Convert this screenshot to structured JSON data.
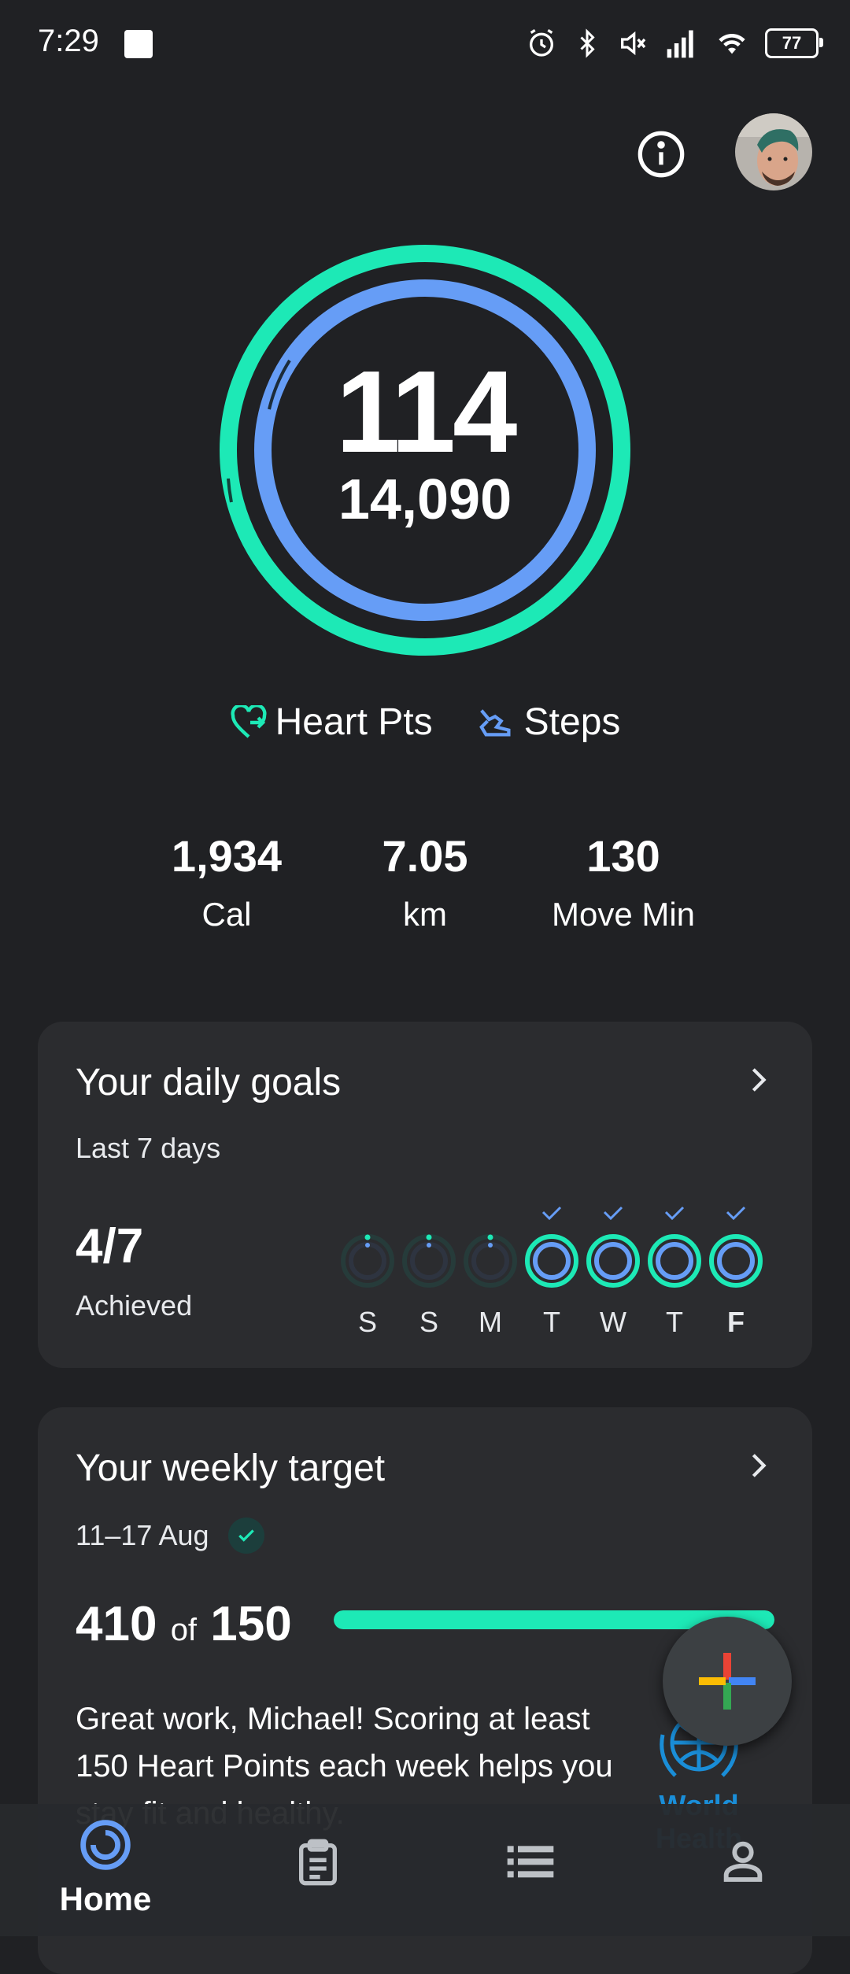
{
  "status_bar": {
    "time": "7:29",
    "battery": "77"
  },
  "summary": {
    "heart_points": "114",
    "steps": "14,090",
    "legend": {
      "heart_pts_label": "Heart Pts",
      "steps_label": "Steps"
    },
    "rings": {
      "heart_points_progress": 0.97,
      "steps_progress": 0.92
    }
  },
  "stats": [
    {
      "value": "1,934",
      "label": "Cal"
    },
    {
      "value": "7.05",
      "label": "km"
    },
    {
      "value": "130",
      "label": "Move Min"
    }
  ],
  "daily_goals": {
    "title": "Your daily goals",
    "subtitle": "Last 7 days",
    "achieved_count": "4/7",
    "achieved_label": "Achieved",
    "days": [
      {
        "letter": "S",
        "achieved": false,
        "today": false
      },
      {
        "letter": "S",
        "achieved": false,
        "today": false
      },
      {
        "letter": "M",
        "achieved": false,
        "today": false
      },
      {
        "letter": "T",
        "achieved": true,
        "today": false
      },
      {
        "letter": "W",
        "achieved": true,
        "today": false
      },
      {
        "letter": "T",
        "achieved": true,
        "today": false
      },
      {
        "letter": "F",
        "achieved": true,
        "today": true
      }
    ]
  },
  "weekly_target": {
    "title": "Your weekly target",
    "date_range": "11–17 Aug",
    "score": "410",
    "of_label": "of",
    "target": "150",
    "progress": 1.0,
    "message": "Great work, Michael! Scoring at least 150 Heart Points each week helps you stay fit and healthy.",
    "logo_text": "World Health"
  },
  "bottom_nav": {
    "home_label": "Home"
  },
  "colors": {
    "background": "#202124",
    "card": "#2b2c2f",
    "heart_points_green": "#1de9b6",
    "steps_blue": "#669df6"
  }
}
